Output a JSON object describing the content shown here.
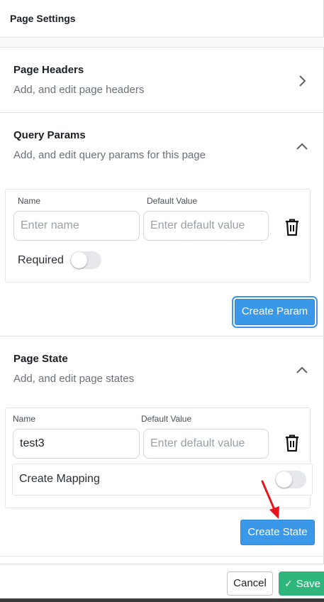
{
  "header": {
    "title": "Page Settings"
  },
  "page_headers": {
    "title": "Page Headers",
    "subtitle": "Add, and edit page headers",
    "chevron_icon": "chevron-right-icon"
  },
  "query_params": {
    "title": "Query Params",
    "subtitle": "Add, and edit query params for this page",
    "chevron_icon": "chevron-up-icon",
    "name_label": "Name",
    "default_label": "Default Value",
    "name_placeholder": "Enter name",
    "default_placeholder": "Enter default value",
    "required_label": "Required",
    "required_on": false,
    "create_button": "Create Param"
  },
  "page_state": {
    "title": "Page State",
    "subtitle": "Add, and edit page states",
    "chevron_icon": "chevron-up-icon",
    "name_label": "Name",
    "default_label": "Default Value",
    "name_value": "test3",
    "default_placeholder": "Enter default value",
    "mapping_label": "Create Mapping",
    "mapping_on": false,
    "create_button": "Create State"
  },
  "footer": {
    "cancel_label": "Cancel",
    "save_label": "Save"
  },
  "colors": {
    "primary": "#3b97e8",
    "save": "#2eb67d",
    "annotation_arrow": "#e8141c"
  }
}
